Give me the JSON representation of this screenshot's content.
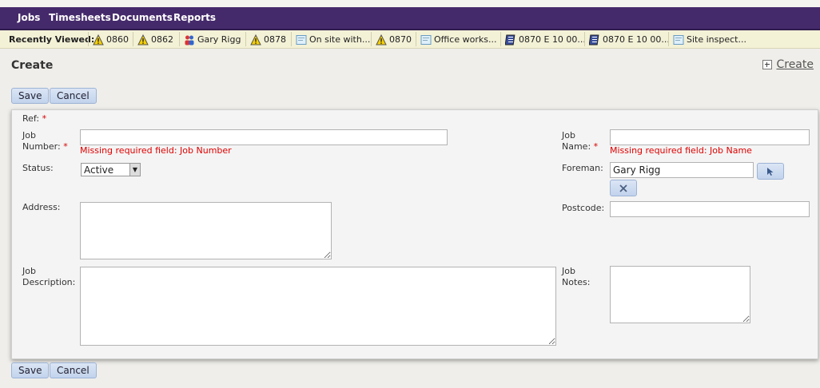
{
  "nav": {
    "items": [
      "Jobs",
      "Timesheets",
      "Documents",
      "Reports"
    ]
  },
  "recent": {
    "label": "Recently Viewed:",
    "items": [
      {
        "icon": "warning-icon",
        "text": "0860"
      },
      {
        "icon": "warning-icon",
        "text": "0862"
      },
      {
        "icon": "users-icon",
        "text": "Gary Rigg"
      },
      {
        "icon": "warning-icon",
        "text": "0878"
      },
      {
        "icon": "document-icon",
        "text": "On site with..."
      },
      {
        "icon": "warning-icon",
        "text": "0870"
      },
      {
        "icon": "document-icon",
        "text": "Office works..."
      },
      {
        "icon": "timesheet-icon",
        "text": "0870 E 10 00..."
      },
      {
        "icon": "timesheet-icon",
        "text": "0870 E 10 00..."
      },
      {
        "icon": "document-icon",
        "text": "Site inspect..."
      }
    ]
  },
  "page": {
    "title": "Create",
    "create_link": "Create"
  },
  "buttons": {
    "save": "Save",
    "cancel": "Cancel"
  },
  "form": {
    "ref_label": "Ref:",
    "required_mark": "*",
    "job_number_label_1": "Job",
    "job_number_label_2": "Number:",
    "job_number_value": "",
    "job_number_error": "Missing required field: Job Number",
    "job_name_label_1": "Job",
    "job_name_label_2": "Name:",
    "job_name_value": "",
    "job_name_error": "Missing required field: Job Name",
    "status_label": "Status:",
    "status_value": "Active",
    "foreman_label": "Foreman:",
    "foreman_value": "Gary Rigg",
    "address_label": "Address:",
    "postcode_label": "Postcode:",
    "job_description_label_1": "Job",
    "job_description_label_2": "Description:",
    "job_notes_label_1": "Job",
    "job_notes_label_2": "Notes:"
  },
  "colors": {
    "nav_bg": "#452a6b",
    "recent_bg": "#f3f1d6",
    "error": "#e00000",
    "button_bg": "#c8d8ee"
  }
}
